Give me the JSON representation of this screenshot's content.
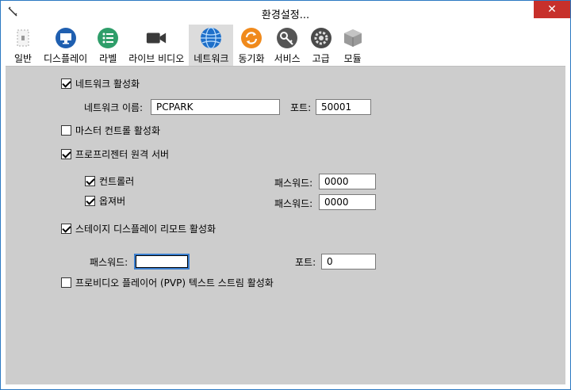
{
  "window": {
    "title": "환경설정...",
    "close_glyph": "✕"
  },
  "colors": {
    "accent": "#2b78c2",
    "close": "#c7302b",
    "content_bg": "#cdcdcd",
    "active_tab": "#dcdcdc"
  },
  "toolbar": [
    {
      "label": "일반",
      "icon": "general-icon"
    },
    {
      "label": "디스플레이",
      "icon": "monitor-icon"
    },
    {
      "label": "라벨",
      "icon": "list-icon"
    },
    {
      "label": "라이브 비디오",
      "icon": "camera-icon"
    },
    {
      "label": "네트워크",
      "icon": "globe-icon",
      "active": true
    },
    {
      "label": "동기화",
      "icon": "sync-icon"
    },
    {
      "label": "서비스",
      "icon": "key-icon"
    },
    {
      "label": "고급",
      "icon": "gear-icon"
    },
    {
      "label": "모듈",
      "icon": "cube-icon"
    }
  ],
  "network": {
    "enable_label": "네트워크 활성화",
    "enabled": true,
    "name_label": "네트워크 이름:",
    "name_value": "PCPARK",
    "port_label": "포트:",
    "port_value": "50001"
  },
  "master_control": {
    "label": "마스터 컨트롤 활성화",
    "checked": false
  },
  "propresenter": {
    "label": "프로프리젠터 원격 서버",
    "checked": true,
    "controller_label": "컨트롤러",
    "controller_checked": true,
    "controller_password_label": "패스워드:",
    "controller_password": "0000",
    "observer_label": "옵져버",
    "observer_checked": true,
    "observer_password_label": "패스워드:",
    "observer_password": "0000"
  },
  "stage": {
    "label": "스테이지 디스플레이 리모트 활성화",
    "checked": true,
    "password_label": "패스워드:",
    "password_value": "",
    "port_label": "포트:",
    "port_value": "0"
  },
  "pvp": {
    "label": "프로비디오 플레이어 (PVP) 텍스트 스트림 활성화",
    "checked": false
  }
}
